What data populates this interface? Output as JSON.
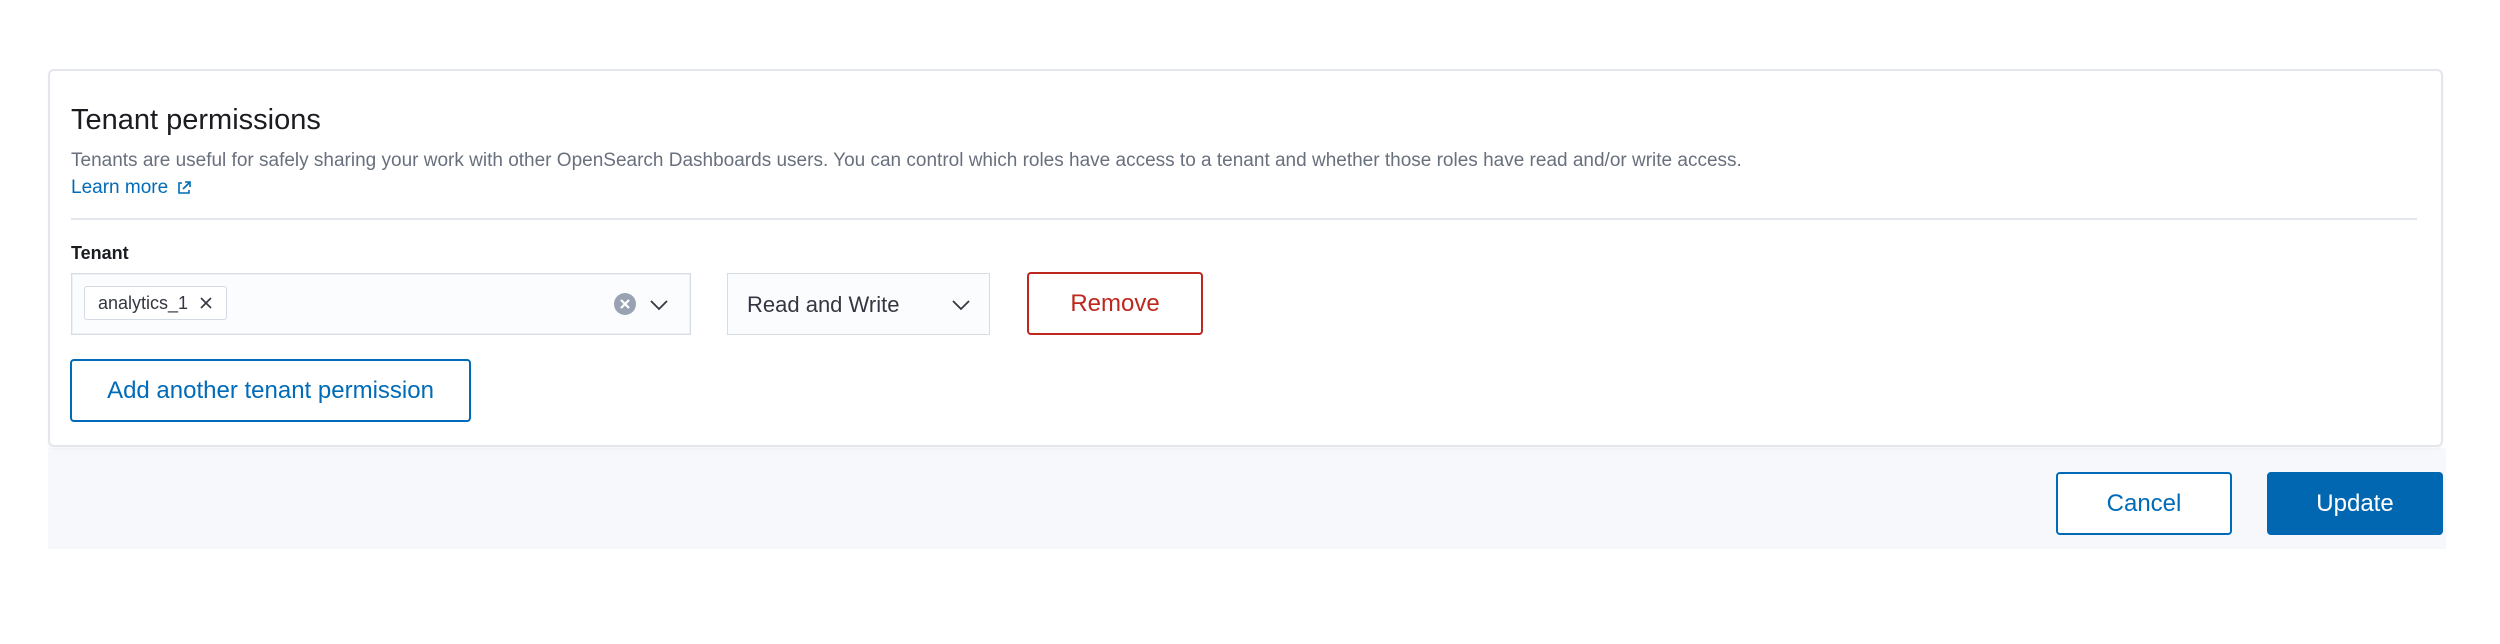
{
  "panel": {
    "title": "Tenant permissions",
    "description": "Tenants are useful for safely sharing your work with other OpenSearch Dashboards users. You can control which roles have access to a tenant and whether those roles have read and/or write access.",
    "learn_more": "Learn more",
    "learn_more_icon": "external-link-icon"
  },
  "tenant_field": {
    "label": "Tenant",
    "selected": [
      "analytics_1"
    ],
    "chip_remove_icon": "close-icon",
    "clear_icon": "clear-circle-icon",
    "dropdown_icon": "chevron-down-icon"
  },
  "permission_select": {
    "value": "Read and Write",
    "dropdown_icon": "chevron-down-icon"
  },
  "buttons": {
    "remove": "Remove",
    "add_another": "Add another tenant permission",
    "cancel": "Cancel",
    "update": "Update"
  },
  "colors": {
    "primary": "#0067b0",
    "link": "#006bb8",
    "danger": "#bd271e",
    "text": "#1a1c21",
    "subdued_text": "#69707d",
    "border": "#d7dbe3",
    "footer_bg": "#f7f8fc"
  }
}
